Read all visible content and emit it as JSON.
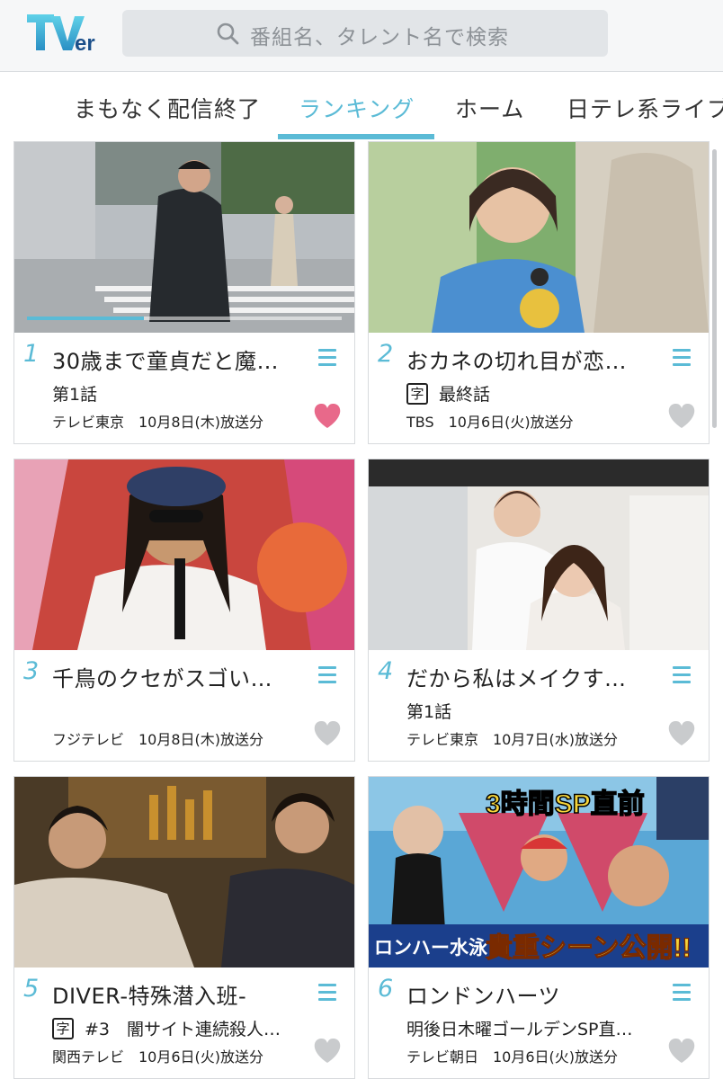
{
  "header": {
    "logo_text": "TVer",
    "search_placeholder": "番組名、タレント名で検索"
  },
  "tabs": [
    {
      "label": "まもなく配信終了",
      "active": false
    },
    {
      "label": "ランキング",
      "active": true
    },
    {
      "label": "ホーム",
      "active": false
    },
    {
      "label": "日テレ系ライブ",
      "active": false
    }
  ],
  "colors": {
    "accent": "#5bbbd6",
    "heart_active": "#e8698a",
    "heart_inactive": "#c9cbcd"
  },
  "cards": [
    {
      "rank": "1",
      "title": "30歳まで童貞だと魔…",
      "subtitle_badge": "",
      "episode": "第1話",
      "broadcast": "テレビ東京　10月8日(木)放送分",
      "favorited": true,
      "watched_progress": 0.37
    },
    {
      "rank": "2",
      "title": "おカネの切れ目が恋…",
      "subtitle_badge": "字",
      "episode": "最終話",
      "broadcast": "TBS　10月6日(火)放送分",
      "favorited": false
    },
    {
      "rank": "3",
      "title": "千鳥のクセがスゴい…",
      "subtitle_badge": "",
      "episode": "",
      "broadcast": "フジテレビ　10月8日(木)放送分",
      "favorited": false
    },
    {
      "rank": "4",
      "title": "だから私はメイクす…",
      "subtitle_badge": "",
      "episode": "第1話",
      "broadcast": "テレビ東京　10月7日(水)放送分",
      "favorited": false
    },
    {
      "rank": "5",
      "title": "DIVER-特殊潜入班-",
      "subtitle_badge": "字",
      "episode": "#3　闇サイト連続殺人…",
      "broadcast": "関西テレビ　10月6日(火)放送分",
      "favorited": false
    },
    {
      "rank": "6",
      "title": "ロンドンハーツ",
      "subtitle_badge": "",
      "episode": "明後日木曜ゴールデンSP直…",
      "broadcast": "テレビ朝日　10月6日(火)放送分",
      "favorited": false
    }
  ],
  "thumbnail_captions": {
    "card6_top": "3時間SP直前",
    "card6_left": "ロンハー水泳",
    "card6_right": "貴重シーン公開!!"
  }
}
